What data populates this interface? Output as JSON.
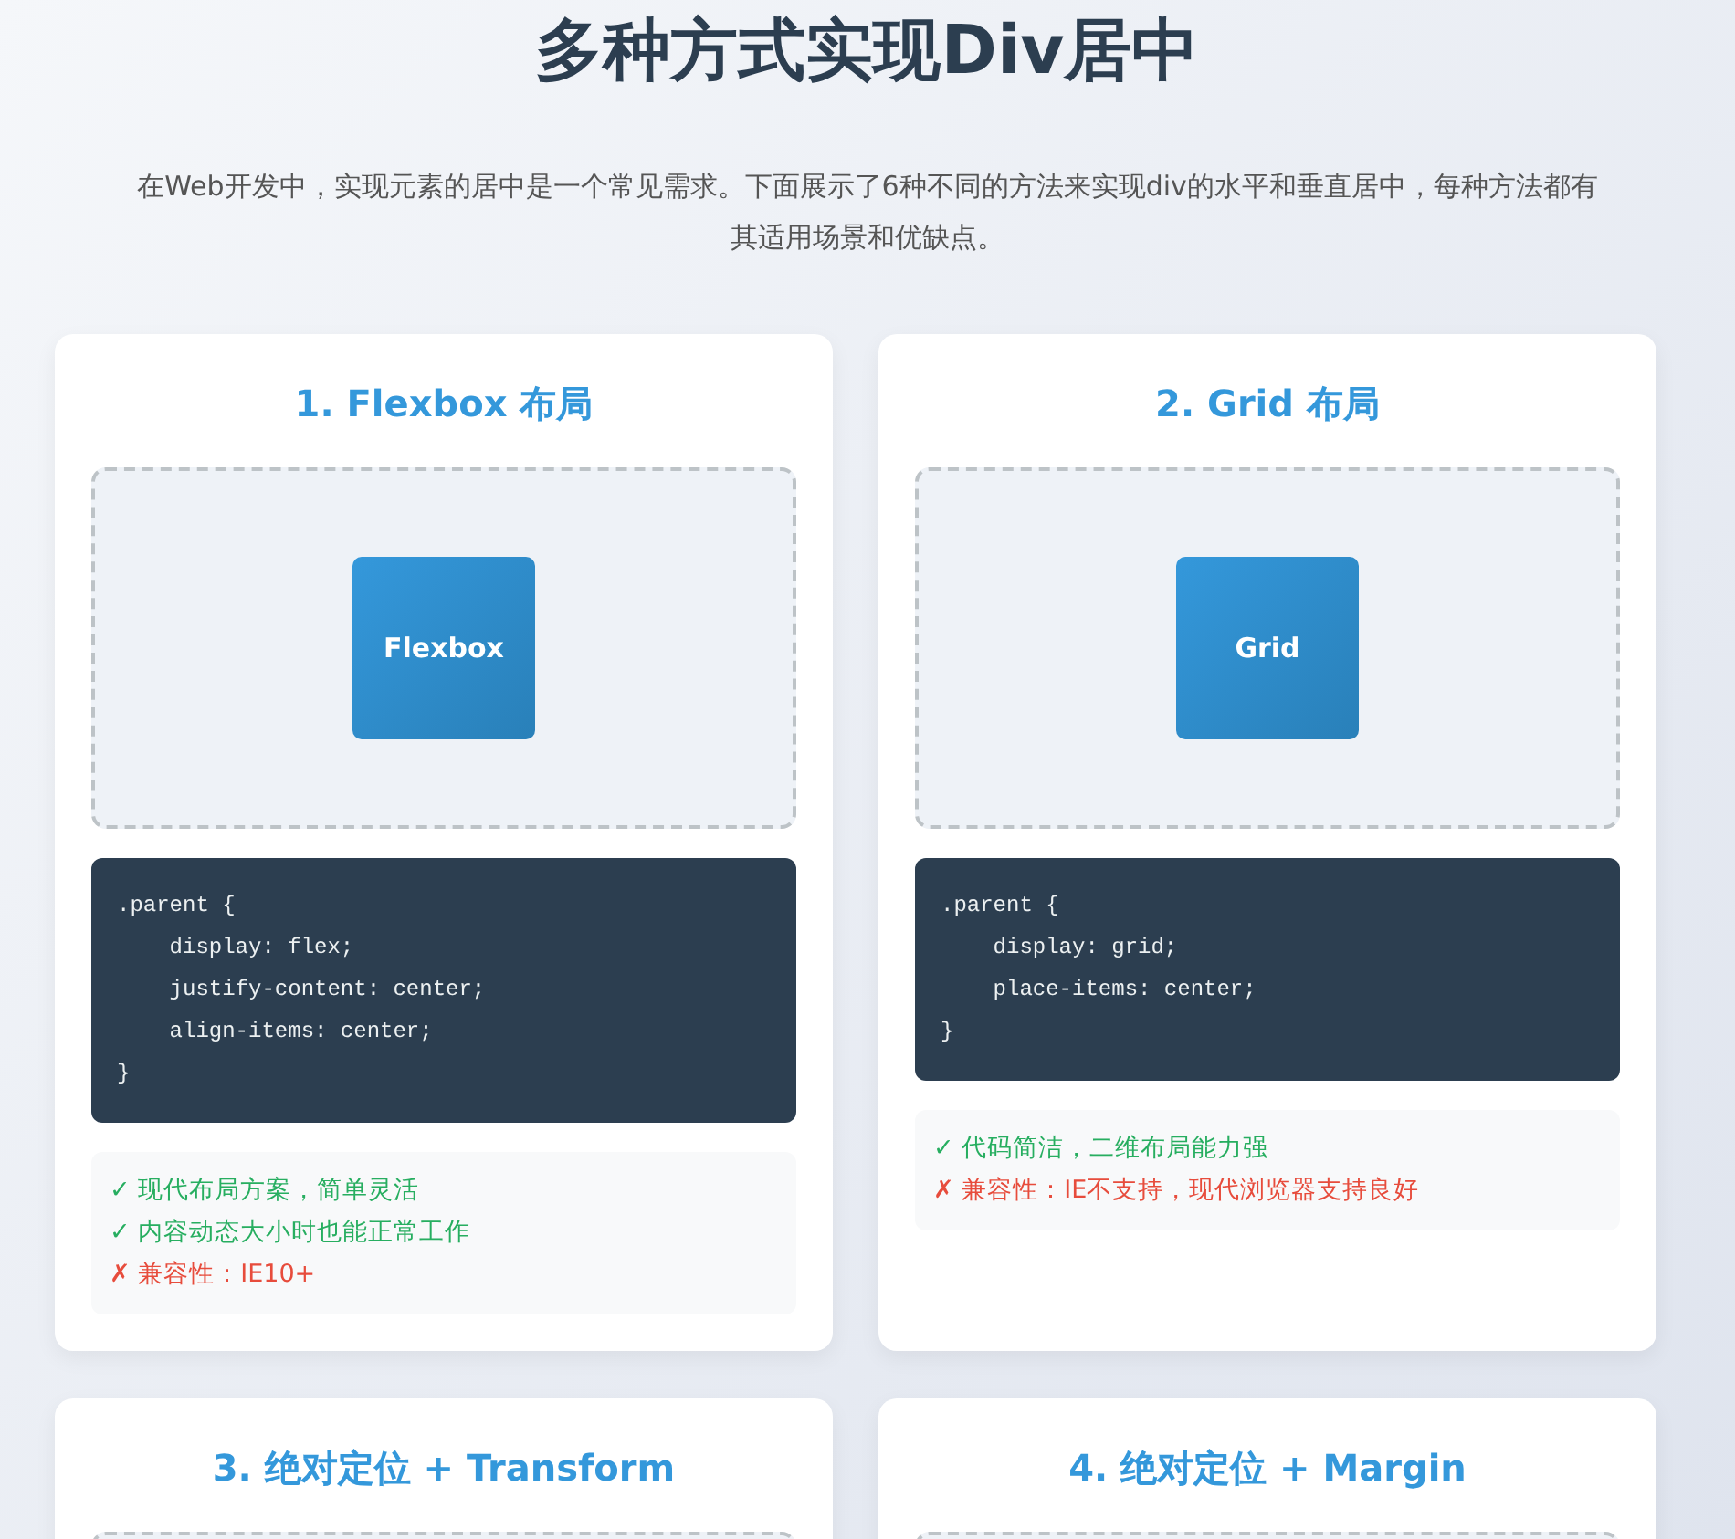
{
  "title": "多种方式实现Div居中",
  "intro": "在Web开发中，实现元素的居中是一个常见需求。下面展示了6种不同的方法来实现div的水平和垂直居中，每种方法都有其适用场景和优缺点。",
  "cards": [
    {
      "title": "1. Flexbox 布局",
      "demo_label": "Flexbox",
      "code": ".parent {\n    display: flex;\n    justify-content: center;\n    align-items: center;\n}",
      "notes": [
        {
          "kind": "pro",
          "text": "✓ 现代布局方案，简单灵活"
        },
        {
          "kind": "pro",
          "text": "✓ 内容动态大小时也能正常工作"
        },
        {
          "kind": "con",
          "text": "✗ 兼容性：IE10+"
        }
      ]
    },
    {
      "title": "2. Grid 布局",
      "demo_label": "Grid",
      "code": ".parent {\n    display: grid;\n    place-items: center;\n}",
      "notes": [
        {
          "kind": "pro",
          "text": "✓ 代码简洁，二维布局能力强"
        },
        {
          "kind": "con",
          "text": "✗ 兼容性：IE不支持，现代浏览器支持良好"
        }
      ]
    },
    {
      "title": "3. 绝对定位 + Transform"
    },
    {
      "title": "4. 绝对定位 + Margin"
    }
  ]
}
